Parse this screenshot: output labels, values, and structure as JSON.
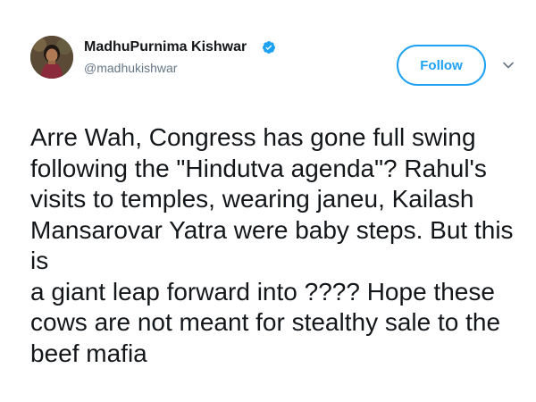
{
  "author": {
    "display_name": "MadhuPurnima Kishwar",
    "handle": "@madhukishwar",
    "verified": true
  },
  "actions": {
    "follow_label": "Follow"
  },
  "icons": {
    "avatar": "profile-photo",
    "verified": "verified-badge-icon",
    "caret": "chevron-down-icon"
  },
  "colors": {
    "accent": "#1da1f2",
    "text": "#14171a",
    "secondary": "#657786"
  },
  "tweet": {
    "text": "Arre Wah, Congress has gone full swing\nfollowing the \"Hindutva agenda\"? Rahul's\nvisits to temples, wearing janeu, Kailash\nMansarovar Yatra were baby steps. But this is\na giant leap forward into ???? Hope these\ncows are not meant for stealthy sale to the\nbeef mafia"
  }
}
